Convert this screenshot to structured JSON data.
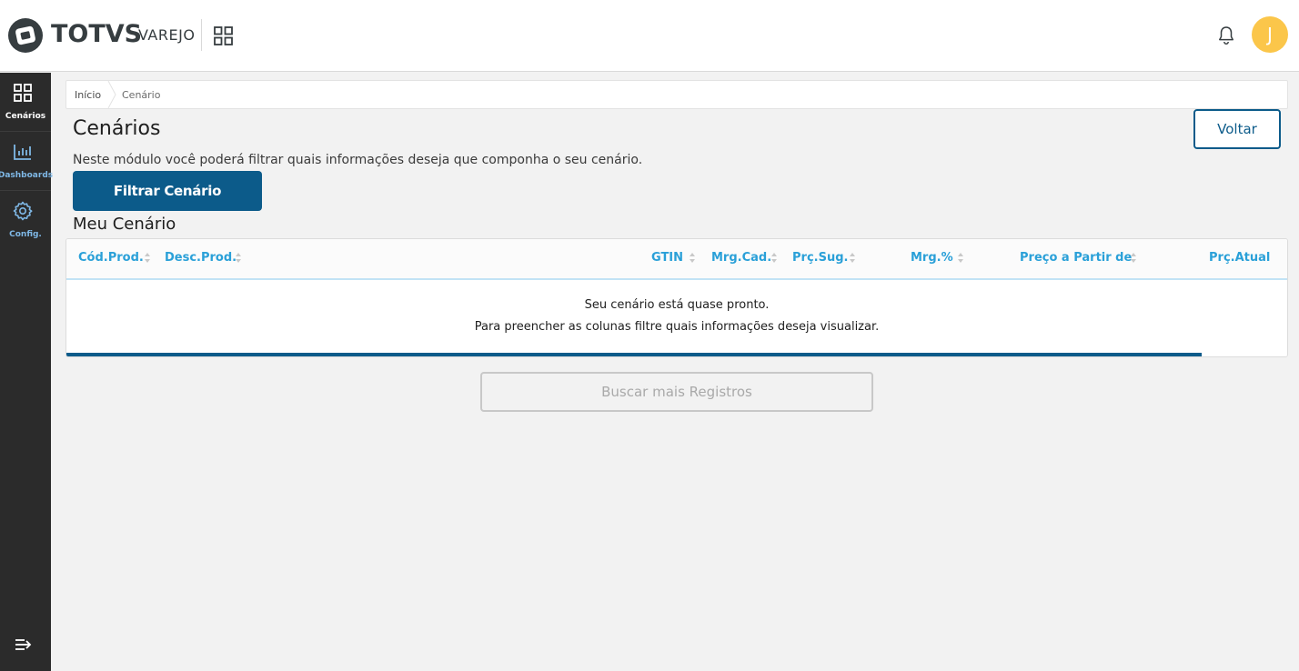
{
  "header": {
    "brand_name": "TOTVS",
    "brand_product": "VAREJO",
    "avatar_initial": "J",
    "avatar_color": "#fbc64a",
    "icons": [
      "apps-grid-icon",
      "bell-icon"
    ]
  },
  "sidebar": {
    "items": [
      {
        "label": "Cenários",
        "icon": "grid-icon",
        "active": true
      },
      {
        "label": "Dashboards",
        "icon": "bar-chart-icon",
        "active": false
      },
      {
        "label": "Config.",
        "icon": "gear-icon",
        "active": false
      }
    ],
    "collapse_icon": "expand-menu-icon"
  },
  "breadcrumb": {
    "home": "Início",
    "current": "Cenário"
  },
  "page": {
    "title": "Cenários",
    "description": "Neste módulo você poderá filtrar quais informações deseja que componha o seu cenário.",
    "back_button": "Voltar",
    "filter_button": "Filtrar Cenário",
    "section_title": "Meu Cenário"
  },
  "table": {
    "columns": [
      "Cód.Prod.",
      "Desc.Prod.",
      "GTIN",
      "Mrg.Cad.",
      "Prç.Sug.",
      "Mrg.%",
      "Preço a Partir de",
      "Prç.Atual"
    ],
    "empty_line_1": "Seu cenário está quase pronto.",
    "empty_line_2": "Para preencher as colunas filtre quais informações deseja visualizar.",
    "loading_progress": 0.93
  },
  "load_more_button": "Buscar mais Registros",
  "colors": {
    "primary": "#0c5b8a",
    "header_text": "#2aa0d8",
    "sidebar_bg": "#2b2b2b",
    "page_bg": "#f2f2f2"
  }
}
